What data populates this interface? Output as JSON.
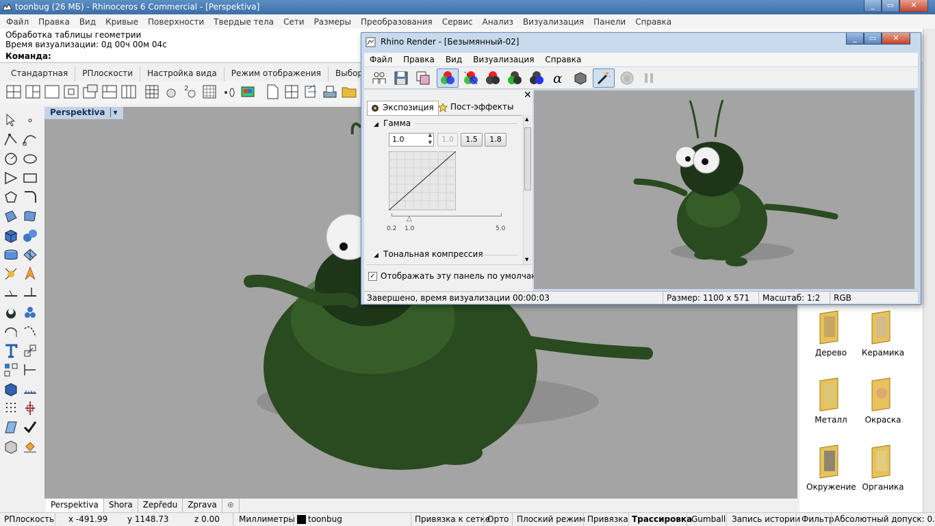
{
  "main_title": "toonbug (26 МБ) - Rhinoceros 6 Commercial - [Perspektiva]",
  "menu": [
    "Файл",
    "Правка",
    "Вид",
    "Кривые",
    "Поверхности",
    "Твердые тела",
    "Сети",
    "Размеры",
    "Преобразования",
    "Сервис",
    "Анализ",
    "Визуализация",
    "Панели",
    "Справка"
  ],
  "command": {
    "history_1": "Обработка таблицы геометрии",
    "history_2": "Время визуализации: 0д 00ч 00м 04с",
    "prompt": "Команда:"
  },
  "toolbar_tabs": [
    "Стандартная",
    "РПлоскости",
    "Настройка вида",
    "Режим отображения",
    "Выбор объектов"
  ],
  "viewport": {
    "title": "Perspektiva",
    "dropdown_icon": "chevron-down-icon"
  },
  "view_tabs": [
    "Perspektiva",
    "Shora",
    "Zepředu",
    "Zprava"
  ],
  "add_view_icon": "plus-icon",
  "status": {
    "cplane": "РПлоскость",
    "x": "x -491.99",
    "y": "y 1148.73",
    "z": "z 0.00",
    "units": "Миллиметры",
    "layer": "toonbug",
    "grid_snap": "Привязка к сетке",
    "ortho": "Орто",
    "planar": "Плоский режим",
    "osnap": "Привязка",
    "smarttrack": "Трассировка",
    "gumball": "Gumball",
    "record_history": "Запись истории",
    "filter": "Фильтр",
    "tolerance": "Абсолютный допуск: 0...."
  },
  "materials": [
    {
      "label": "Дерево"
    },
    {
      "label": "Керамика"
    },
    {
      "label": "Металл"
    },
    {
      "label": "Окраска"
    },
    {
      "label": "Окружение"
    },
    {
      "label": "Органика"
    }
  ],
  "render_window": {
    "title": "Rhino Render - [Безымянный-02]",
    "menu": [
      "Файл",
      "Правка",
      "Вид",
      "Визуализация",
      "Справка"
    ],
    "tabs": {
      "exposure": "Экспозиция",
      "post_effects": "Пост-эффекты"
    },
    "gamma": {
      "section_label": "Гамма",
      "value": "1.0",
      "presets": [
        "1.0",
        "1.5",
        "1.8"
      ],
      "slider_min": "0.2",
      "slider_current": "1.0",
      "slider_max": "5.0"
    },
    "tonemap_label": "Тональная компрессия",
    "default_panel_label": "Отображать эту панель по умолчанию",
    "default_panel_checked": true,
    "status": {
      "done": "Завершено, время визуализации 00:00:03",
      "size": "Размер: 1100 x 571",
      "scale": "Масштаб: 1:2",
      "color": "RGB"
    }
  }
}
